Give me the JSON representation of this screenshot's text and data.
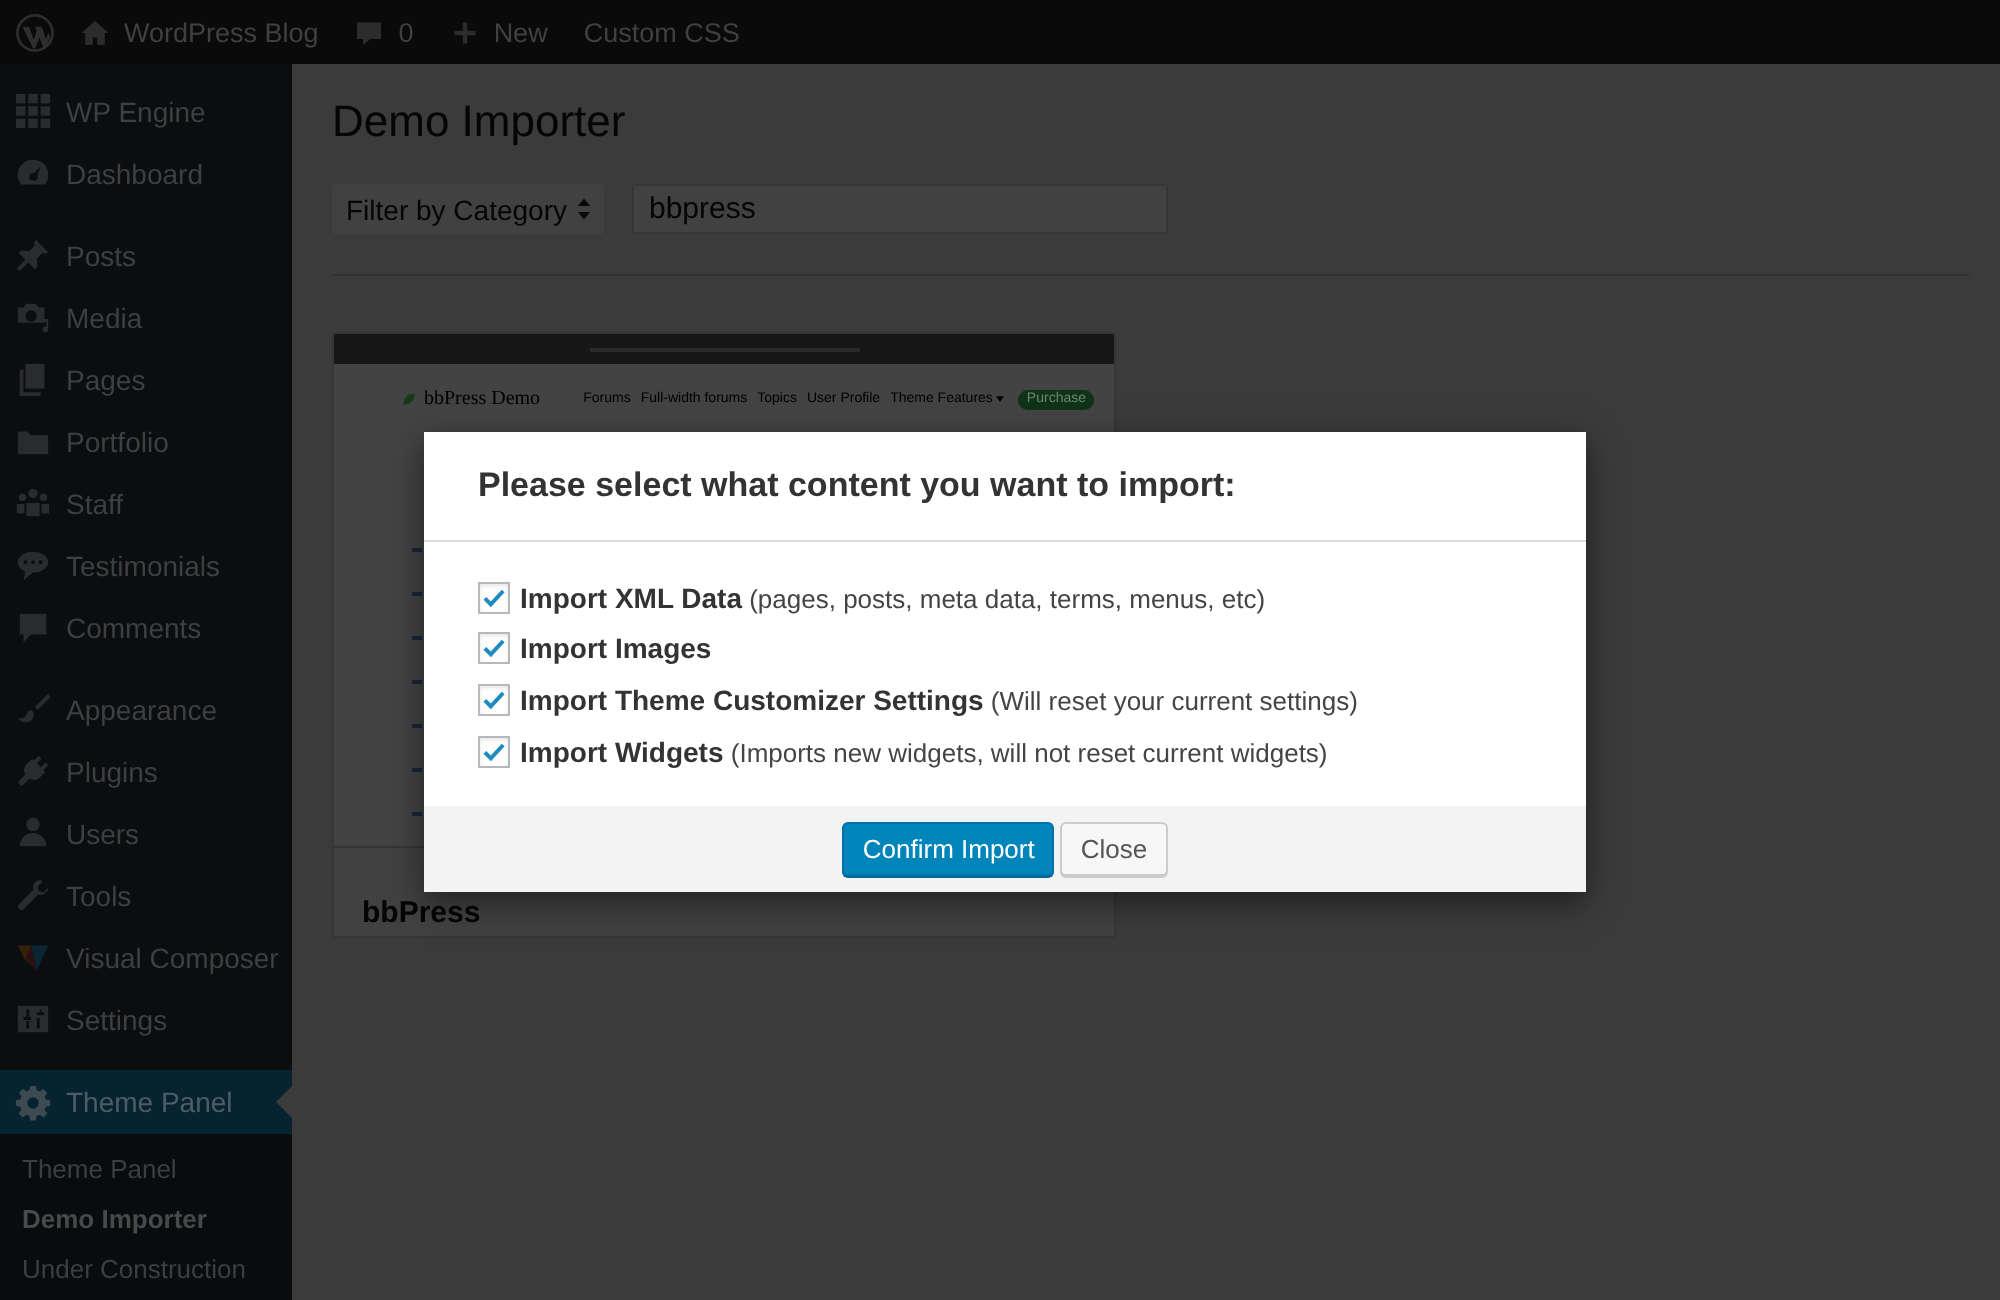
{
  "admin_bar": {
    "items": [
      {
        "label": "WordPress Blog"
      },
      {
        "label": "0"
      },
      {
        "label": "New"
      },
      {
        "label": "Custom CSS"
      }
    ]
  },
  "sidebar": {
    "groups": [
      {
        "items": [
          {
            "label": "WP Engine",
            "selected": false
          },
          {
            "label": "Dashboard",
            "selected": false
          }
        ]
      },
      {
        "items": [
          {
            "label": "Posts",
            "selected": false
          },
          {
            "label": "Media",
            "selected": false
          },
          {
            "label": "Pages",
            "selected": false
          },
          {
            "label": "Portfolio",
            "selected": false
          },
          {
            "label": "Staff",
            "selected": false
          },
          {
            "label": "Testimonials",
            "selected": false
          },
          {
            "label": "Comments",
            "selected": false
          }
        ]
      },
      {
        "items": [
          {
            "label": "Appearance",
            "selected": false
          },
          {
            "label": "Plugins",
            "selected": false
          },
          {
            "label": "Users",
            "selected": false
          },
          {
            "label": "Tools",
            "selected": false
          },
          {
            "label": "Visual Composer",
            "selected": false
          },
          {
            "label": "Settings",
            "selected": false
          }
        ]
      },
      {
        "items": [
          {
            "label": "Theme Panel",
            "selected": true,
            "children": [
              {
                "label": "Theme Panel",
                "selected": false
              },
              {
                "label": "Demo Importer",
                "selected": true
              },
              {
                "label": "Under Construction",
                "selected": false
              }
            ]
          }
        ]
      }
    ]
  },
  "page": {
    "title": "Demo Importer",
    "filter": {
      "value": "Filter by Category"
    },
    "search": {
      "value": "bbpress"
    },
    "demos": [
      {
        "name": "bbPress",
        "preview": {
          "site_title": "bbPress Demo",
          "nav": [
            {
              "label": "Forums",
              "dropdown": false
            },
            {
              "label": "Full-width forums",
              "dropdown": false
            },
            {
              "label": "Topics",
              "dropdown": false
            },
            {
              "label": "User Profile",
              "dropdown": false
            },
            {
              "label": "Theme Features",
              "dropdown": true
            }
          ],
          "button": "Purchase"
        }
      }
    ]
  },
  "dialog": {
    "title": "Please select what content you want to import:",
    "options": [
      {
        "label": "**Import XML Data** (pages, posts, meta data, terms, menus, etc)",
        "checked": true
      },
      {
        "label": "**Import Images**",
        "checked": true
      },
      {
        "label": "**Import Theme Customizer Settings** (Will reset your current settings)",
        "checked": true
      },
      {
        "label": "**Import Widgets** (Imports new widgets, will not reset current widgets)",
        "checked": true
      }
    ],
    "buttons": [
      {
        "label": "Confirm Import",
        "kind": "primary"
      },
      {
        "label": "Close",
        "kind": "secondary"
      }
    ]
  }
}
